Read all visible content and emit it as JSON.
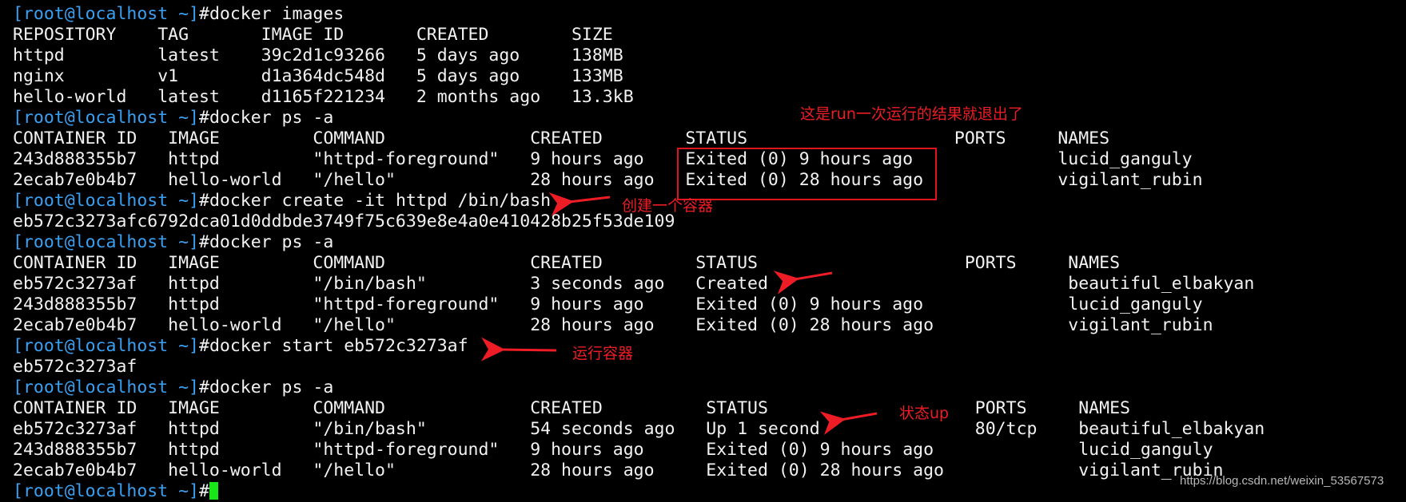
{
  "terminal": {
    "prompt": "[root@localhost ~]",
    "prompt_symbol": "#",
    "commands": [
      "docker images",
      "docker ps -a",
      "docker create -it httpd /bin/bash",
      "docker ps -a",
      "docker start eb572c3273af",
      "docker ps -a",
      ""
    ],
    "images_table": {
      "headers": [
        "REPOSITORY",
        "TAG",
        "IMAGE ID",
        "CREATED",
        "SIZE"
      ],
      "rows": [
        [
          "httpd",
          "latest",
          "39c2d1c93266",
          "5 days ago",
          "138MB"
        ],
        [
          "nginx",
          "v1",
          "d1a364dc548d",
          "5 days ago",
          "133MB"
        ],
        [
          "hello-world",
          "latest",
          "d1165f221234",
          "2 months ago",
          "13.3kB"
        ]
      ]
    },
    "ps1": {
      "headers": [
        "CONTAINER ID",
        "IMAGE",
        "COMMAND",
        "CREATED",
        "STATUS",
        "PORTS",
        "NAMES"
      ],
      "rows": [
        [
          "243d888355b7",
          "httpd",
          "\"httpd-foreground\"",
          "9 hours ago",
          "Exited (0) 9 hours ago",
          "",
          "lucid_ganguly"
        ],
        [
          "2ecab7e0b4b7",
          "hello-world",
          "\"/hello\"",
          "28 hours ago",
          "Exited (0) 28 hours ago",
          "",
          "vigilant_rubin"
        ]
      ]
    },
    "create_output": "eb572c3273afc6792dca01d0ddbde3749f75c639e8e4a0e410428b25f53de109",
    "ps2": {
      "headers": [
        "CONTAINER ID",
        "IMAGE",
        "COMMAND",
        "CREATED",
        "STATUS",
        "PORTS",
        "NAMES"
      ],
      "rows": [
        [
          "eb572c3273af",
          "httpd",
          "\"/bin/bash\"",
          "3 seconds ago",
          "Created",
          "",
          "beautiful_elbakyan"
        ],
        [
          "243d888355b7",
          "httpd",
          "\"httpd-foreground\"",
          "9 hours ago",
          "Exited (0) 9 hours ago",
          "",
          "lucid_ganguly"
        ],
        [
          "2ecab7e0b4b7",
          "hello-world",
          "\"/hello\"",
          "28 hours ago",
          "Exited (0) 28 hours ago",
          "",
          "vigilant_rubin"
        ]
      ]
    },
    "start_output": "eb572c3273af",
    "ps3": {
      "headers": [
        "CONTAINER ID",
        "IMAGE",
        "COMMAND",
        "CREATED",
        "STATUS",
        "PORTS",
        "NAMES"
      ],
      "rows": [
        [
          "eb572c3273af",
          "httpd",
          "\"/bin/bash\"",
          "54 seconds ago",
          "Up 1 second",
          "80/tcp",
          "beautiful_elbakyan"
        ],
        [
          "243d888355b7",
          "httpd",
          "\"httpd-foreground\"",
          "9 hours ago",
          "Exited (0) 9 hours ago",
          "",
          "lucid_ganguly"
        ],
        [
          "2ecab7e0b4b7",
          "hello-world",
          "\"/hello\"",
          "28 hours ago",
          "Exited (0) 28 hours ago",
          "",
          "vigilant_rubin"
        ]
      ]
    }
  },
  "annotations": {
    "run_exited": "这是run一次运行的结果就退出了",
    "create_container": "创建一个容器",
    "run_container": "运行容器",
    "status_up": "状态up"
  },
  "watermark": "https://blog.csdn.net/weixin_53567573",
  "colors": {
    "prompt": "#3aa0f2",
    "annotation": "#ee1c25",
    "cursor": "#19e619",
    "background": "#000000"
  }
}
